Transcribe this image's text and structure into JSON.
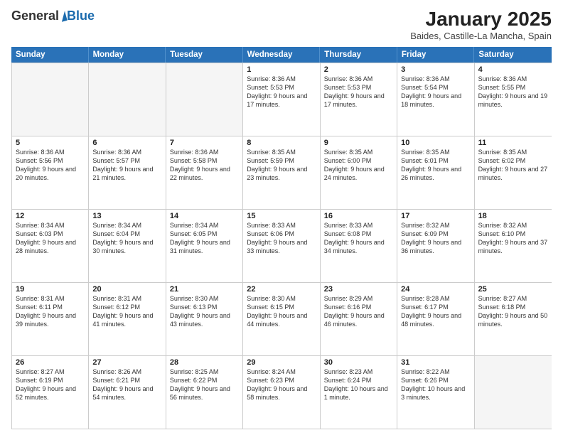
{
  "logo": {
    "general": "General",
    "blue": "Blue"
  },
  "title": "January 2025",
  "subtitle": "Baides, Castille-La Mancha, Spain",
  "days": [
    "Sunday",
    "Monday",
    "Tuesday",
    "Wednesday",
    "Thursday",
    "Friday",
    "Saturday"
  ],
  "weeks": [
    [
      {
        "day": "",
        "info": ""
      },
      {
        "day": "",
        "info": ""
      },
      {
        "day": "",
        "info": ""
      },
      {
        "day": "1",
        "info": "Sunrise: 8:36 AM\nSunset: 5:53 PM\nDaylight: 9 hours\nand 17 minutes."
      },
      {
        "day": "2",
        "info": "Sunrise: 8:36 AM\nSunset: 5:53 PM\nDaylight: 9 hours\nand 17 minutes."
      },
      {
        "day": "3",
        "info": "Sunrise: 8:36 AM\nSunset: 5:54 PM\nDaylight: 9 hours\nand 18 minutes."
      },
      {
        "day": "4",
        "info": "Sunrise: 8:36 AM\nSunset: 5:55 PM\nDaylight: 9 hours\nand 19 minutes."
      }
    ],
    [
      {
        "day": "5",
        "info": "Sunrise: 8:36 AM\nSunset: 5:56 PM\nDaylight: 9 hours\nand 20 minutes."
      },
      {
        "day": "6",
        "info": "Sunrise: 8:36 AM\nSunset: 5:57 PM\nDaylight: 9 hours\nand 21 minutes."
      },
      {
        "day": "7",
        "info": "Sunrise: 8:36 AM\nSunset: 5:58 PM\nDaylight: 9 hours\nand 22 minutes."
      },
      {
        "day": "8",
        "info": "Sunrise: 8:35 AM\nSunset: 5:59 PM\nDaylight: 9 hours\nand 23 minutes."
      },
      {
        "day": "9",
        "info": "Sunrise: 8:35 AM\nSunset: 6:00 PM\nDaylight: 9 hours\nand 24 minutes."
      },
      {
        "day": "10",
        "info": "Sunrise: 8:35 AM\nSunset: 6:01 PM\nDaylight: 9 hours\nand 26 minutes."
      },
      {
        "day": "11",
        "info": "Sunrise: 8:35 AM\nSunset: 6:02 PM\nDaylight: 9 hours\nand 27 minutes."
      }
    ],
    [
      {
        "day": "12",
        "info": "Sunrise: 8:34 AM\nSunset: 6:03 PM\nDaylight: 9 hours\nand 28 minutes."
      },
      {
        "day": "13",
        "info": "Sunrise: 8:34 AM\nSunset: 6:04 PM\nDaylight: 9 hours\nand 30 minutes."
      },
      {
        "day": "14",
        "info": "Sunrise: 8:34 AM\nSunset: 6:05 PM\nDaylight: 9 hours\nand 31 minutes."
      },
      {
        "day": "15",
        "info": "Sunrise: 8:33 AM\nSunset: 6:06 PM\nDaylight: 9 hours\nand 33 minutes."
      },
      {
        "day": "16",
        "info": "Sunrise: 8:33 AM\nSunset: 6:08 PM\nDaylight: 9 hours\nand 34 minutes."
      },
      {
        "day": "17",
        "info": "Sunrise: 8:32 AM\nSunset: 6:09 PM\nDaylight: 9 hours\nand 36 minutes."
      },
      {
        "day": "18",
        "info": "Sunrise: 8:32 AM\nSunset: 6:10 PM\nDaylight: 9 hours\nand 37 minutes."
      }
    ],
    [
      {
        "day": "19",
        "info": "Sunrise: 8:31 AM\nSunset: 6:11 PM\nDaylight: 9 hours\nand 39 minutes."
      },
      {
        "day": "20",
        "info": "Sunrise: 8:31 AM\nSunset: 6:12 PM\nDaylight: 9 hours\nand 41 minutes."
      },
      {
        "day": "21",
        "info": "Sunrise: 8:30 AM\nSunset: 6:13 PM\nDaylight: 9 hours\nand 43 minutes."
      },
      {
        "day": "22",
        "info": "Sunrise: 8:30 AM\nSunset: 6:15 PM\nDaylight: 9 hours\nand 44 minutes."
      },
      {
        "day": "23",
        "info": "Sunrise: 8:29 AM\nSunset: 6:16 PM\nDaylight: 9 hours\nand 46 minutes."
      },
      {
        "day": "24",
        "info": "Sunrise: 8:28 AM\nSunset: 6:17 PM\nDaylight: 9 hours\nand 48 minutes."
      },
      {
        "day": "25",
        "info": "Sunrise: 8:27 AM\nSunset: 6:18 PM\nDaylight: 9 hours\nand 50 minutes."
      }
    ],
    [
      {
        "day": "26",
        "info": "Sunrise: 8:27 AM\nSunset: 6:19 PM\nDaylight: 9 hours\nand 52 minutes."
      },
      {
        "day": "27",
        "info": "Sunrise: 8:26 AM\nSunset: 6:21 PM\nDaylight: 9 hours\nand 54 minutes."
      },
      {
        "day": "28",
        "info": "Sunrise: 8:25 AM\nSunset: 6:22 PM\nDaylight: 9 hours\nand 56 minutes."
      },
      {
        "day": "29",
        "info": "Sunrise: 8:24 AM\nSunset: 6:23 PM\nDaylight: 9 hours\nand 58 minutes."
      },
      {
        "day": "30",
        "info": "Sunrise: 8:23 AM\nSunset: 6:24 PM\nDaylight: 10 hours\nand 1 minute."
      },
      {
        "day": "31",
        "info": "Sunrise: 8:22 AM\nSunset: 6:26 PM\nDaylight: 10 hours\nand 3 minutes."
      },
      {
        "day": "",
        "info": ""
      }
    ]
  ]
}
